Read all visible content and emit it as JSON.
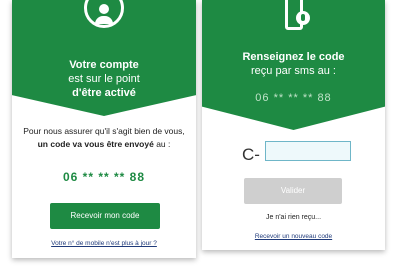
{
  "left": {
    "title": "Votre compte",
    "subtitle_line1": "est sur le point",
    "subtitle_line2": "d'être activé",
    "body_line1": "Pour nous assurer qu'il s'agit bien de vous,",
    "body_line2_bold": "un code va vous être envoyé",
    "body_line2_rest": " au :",
    "phone_masked": "06 ** ** ** 88",
    "receive_button": "Recevoir mon code",
    "outdated_link": "Votre n° de mobile n'est plus à jour ?"
  },
  "right": {
    "title": "Renseignez le code",
    "subtitle": "reçu par sms au :",
    "phone_masked": "06 ** ** ** 88",
    "code_prefix": "C-",
    "code_value": "",
    "validate_button": "Valider",
    "not_received_text": "Je n'ai rien reçu...",
    "new_code_link": "Recevoir un nouveau code"
  },
  "colors": {
    "brand_green": "#1e8a43",
    "disabled_button": "#cfcfcf",
    "input_border": "#6fb6c8",
    "link": "#1f3a7a"
  },
  "icons": {
    "left_header": "user-circle-icon",
    "right_header": "phone-sms-icon"
  }
}
